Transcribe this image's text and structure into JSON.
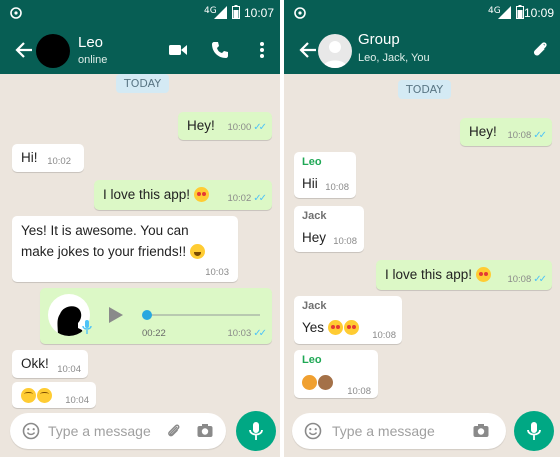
{
  "colors": {
    "header": "#075e54",
    "chat_bg": "#ece5dd",
    "outgoing_bubble": "#dcf8c6",
    "incoming_bubble": "#ffffff",
    "read_ticks": "#4fc3f7",
    "mic_button": "#00a884",
    "date_pill": "#d4eaf4"
  },
  "left": {
    "status": {
      "network": "4G",
      "time": "10:07"
    },
    "header": {
      "name": "Leo",
      "status": "online"
    },
    "date_label": "TODAY",
    "messages": [
      {
        "text": "Hey!",
        "time": "10:00"
      },
      {
        "text": "Hi!",
        "time": "10:02"
      },
      {
        "text": "I love this app!",
        "time": "10:02"
      },
      {
        "line1": "Yes! It is awesome. You can",
        "line2": "make jokes to your friends!!",
        "time": "10:03"
      },
      {
        "duration": "00:22",
        "time": "10:03"
      },
      {
        "text": "Okk!",
        "time": "10:04"
      },
      {
        "time": "10:04"
      }
    ],
    "input": {
      "placeholder": "Type a message"
    }
  },
  "right": {
    "status": {
      "network": "4G",
      "time": "10:09"
    },
    "header": {
      "name": "Group",
      "members": "Leo, Jack, You"
    },
    "date_label": "TODAY",
    "messages": [
      {
        "text": "Hey!",
        "time": "10:08"
      },
      {
        "sender": "Leo",
        "text": "Hii",
        "time": "10:08"
      },
      {
        "sender": "Jack",
        "text": "Hey",
        "time": "10:08"
      },
      {
        "text": "I love this app!",
        "time": "10:08"
      },
      {
        "sender": "Jack",
        "text": "Yes",
        "time": "10:08"
      },
      {
        "sender": "Leo",
        "time": "10:08"
      }
    ],
    "input": {
      "placeholder": "Type a message"
    }
  },
  "icons": {
    "back": "arrow-left-icon",
    "video": "video-call-icon",
    "phone": "phone-call-icon",
    "menu": "more-vert-icon",
    "attach": "paperclip-icon",
    "emoji": "emoji-icon",
    "camera": "camera-icon",
    "mic": "mic-icon",
    "play": "play-icon"
  }
}
